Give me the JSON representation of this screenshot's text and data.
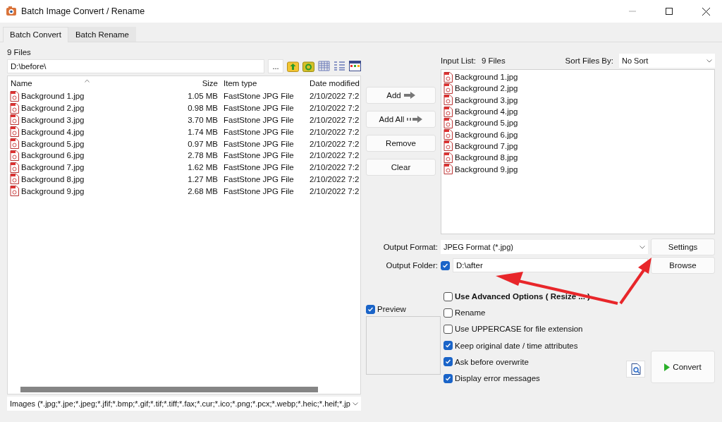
{
  "window": {
    "title": "Batch Image Convert / Rename"
  },
  "tabs": [
    {
      "label": "Batch Convert",
      "selected": true
    },
    {
      "label": "Batch Rename",
      "selected": false
    }
  ],
  "file_count": "9 Files",
  "path_field": {
    "value": "D:\\before\\",
    "browse_label": "..."
  },
  "file_table": {
    "columns": [
      {
        "label": "Name",
        "sorted": true
      },
      {
        "label": "Size",
        "sorted": false
      },
      {
        "label": "Item type",
        "sorted": false
      },
      {
        "label": "Date modified",
        "sorted": false
      }
    ],
    "rows": [
      {
        "name": "Background 1.jpg",
        "size": "1.05 MB",
        "type": "FastStone JPG File",
        "date": "2/10/2022 7:2"
      },
      {
        "name": "Background 2.jpg",
        "size": "0.98 MB",
        "type": "FastStone JPG File",
        "date": "2/10/2022 7:2"
      },
      {
        "name": "Background 3.jpg",
        "size": "3.70 MB",
        "type": "FastStone JPG File",
        "date": "2/10/2022 7:2"
      },
      {
        "name": "Background 4.jpg",
        "size": "1.74 MB",
        "type": "FastStone JPG File",
        "date": "2/10/2022 7:2"
      },
      {
        "name": "Background 5.jpg",
        "size": "0.97 MB",
        "type": "FastStone JPG File",
        "date": "2/10/2022 7:2"
      },
      {
        "name": "Background 6.jpg",
        "size": "2.78 MB",
        "type": "FastStone JPG File",
        "date": "2/10/2022 7:2"
      },
      {
        "name": "Background 7.jpg",
        "size": "1.62 MB",
        "type": "FastStone JPG File",
        "date": "2/10/2022 7:2"
      },
      {
        "name": "Background 8.jpg",
        "size": "1.27 MB",
        "type": "FastStone JPG File",
        "date": "2/10/2022 7:2"
      },
      {
        "name": "Background 9.jpg",
        "size": "2.68 MB",
        "type": "FastStone JPG File",
        "date": "2/10/2022 7:2"
      }
    ]
  },
  "file_filter": "Images (*.jpg;*.jpe;*.jpeg;*.jfif;*.bmp;*.gif;*.tif;*.tiff;*.fax;*.cur;*.ico;*.png;*.pcx;*.webp;*.heic;*.heif;*.jp",
  "transfer_buttons": [
    {
      "label": "Add",
      "kind": "solid_arrow"
    },
    {
      "label": "Add All",
      "kind": "striped_arrow"
    },
    {
      "label": "Remove",
      "kind": "plain"
    },
    {
      "label": "Clear",
      "kind": "plain"
    }
  ],
  "input_list": {
    "label": "Input List:",
    "count": "9 Files",
    "sort_label": "Sort Files By:",
    "sort_value": "No Sort",
    "items": [
      "Background 1.jpg",
      "Background 2.jpg",
      "Background 3.jpg",
      "Background 4.jpg",
      "Background 5.jpg",
      "Background 6.jpg",
      "Background 7.jpg",
      "Background 8.jpg",
      "Background 9.jpg"
    ]
  },
  "output_format": {
    "label": "Output Format:",
    "value": "JPEG Format (*.jpg)",
    "button": "Settings"
  },
  "output_folder": {
    "label": "Output Folder:",
    "checked": true,
    "value": "D:\\after",
    "button": "Browse"
  },
  "preview": {
    "label": "Preview",
    "checked": true
  },
  "options": [
    {
      "label": "Use Advanced Options ( Resize ... )",
      "checked": false,
      "kind": "heading"
    },
    {
      "label": "Rename",
      "checked": false,
      "kind": "plain"
    },
    {
      "label": "Use UPPERCASE for file extension",
      "checked": false,
      "kind": "plain"
    },
    {
      "label": "Keep original date / time attributes",
      "checked": true,
      "kind": "plain"
    },
    {
      "label": "Ask before overwrite",
      "checked": true,
      "kind": "plain"
    },
    {
      "label": "Display error messages",
      "checked": true,
      "kind": "plain"
    }
  ],
  "convert_button": "Convert"
}
